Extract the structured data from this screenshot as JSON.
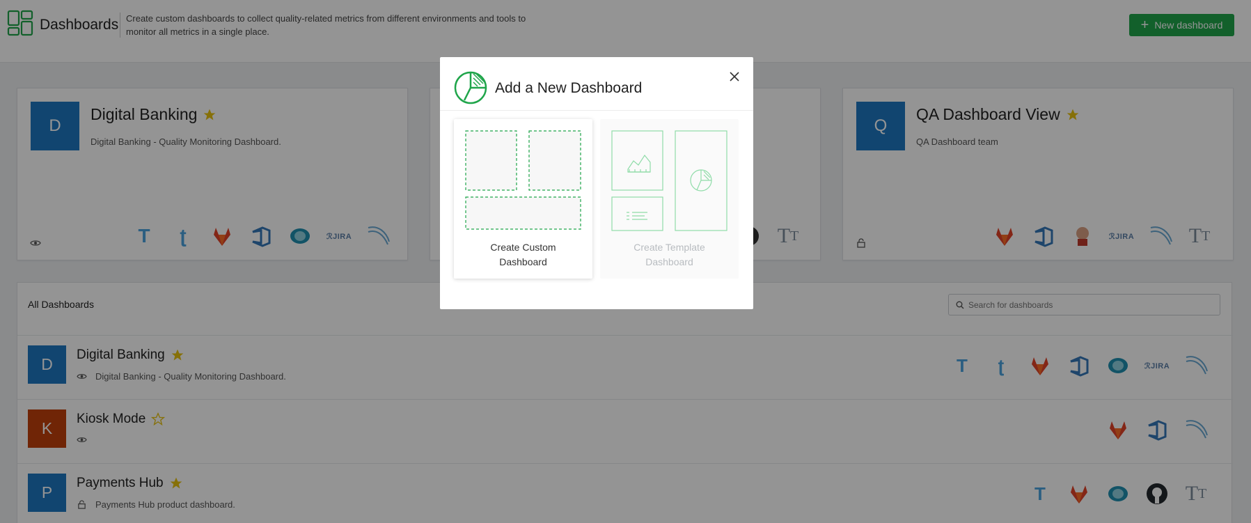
{
  "header": {
    "title": "Dashboards",
    "description": "Create custom dashboards to collect quality-related metrics from different environments and tools to monitor all metrics in a single place.",
    "new_button": "New dashboard"
  },
  "colors": {
    "brand_green": "#1fa54a",
    "avatar_blue": "#1e78c2",
    "avatar_orange": "#c2410c",
    "star": "#e7c10f"
  },
  "cards": [
    {
      "initial": "D",
      "title": "Digital Banking",
      "description": "Digital Banking - Quality Monitoring Dashboard.",
      "visibility_icon": "eye-icon",
      "tools": [
        "testrail-icon",
        "testlink-icon",
        "gitlab-icon",
        "azure-devops-icon",
        "eye-tool-icon",
        "jira-icon",
        "bamboo-icon"
      ]
    },
    {
      "initial": "Q",
      "title": "QA Dashboard View",
      "description": "QA Dashboard team",
      "visibility_icon": "lock-open-icon",
      "tools": [
        "gitlab-icon",
        "azure-devops-icon",
        "jenkins-icon",
        "jira-icon",
        "bamboo-icon",
        "text-widget-icon"
      ]
    }
  ],
  "list": {
    "title": "All Dashboards",
    "search_placeholder": "Search for dashboards",
    "rows": [
      {
        "initial": "D",
        "title": "Digital Banking",
        "favorite": true,
        "description": "Digital Banking - Quality Monitoring Dashboard.",
        "visibility_icon": "eye-icon"
      },
      {
        "initial": "K",
        "title": "Kiosk Mode",
        "favorite": false,
        "description": "",
        "visibility_icon": "eye-icon"
      },
      {
        "initial": "P",
        "title": "Payments Hub",
        "favorite": true,
        "description": "Payments Hub product dashboard.",
        "visibility_icon": "lock-open-icon"
      }
    ]
  },
  "modal": {
    "title": "Add a New Dashboard",
    "options": [
      {
        "label_line1": "Create Custom",
        "label_line2": "Dashboard",
        "enabled": true
      },
      {
        "label_line1": "Create Template",
        "label_line2": "Dashboard",
        "enabled": false
      }
    ]
  }
}
